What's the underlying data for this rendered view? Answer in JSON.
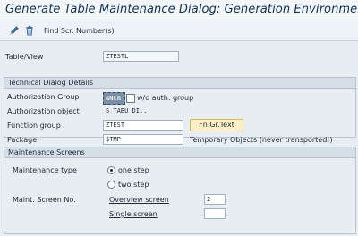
{
  "window": {
    "title": "Generate Table Maintenance Dialog: Generation Environment"
  },
  "toolbar": {
    "edit_icon": "pencil-icon",
    "delete_icon": "trash-icon",
    "find_label": "Find Scr. Number(s)"
  },
  "header": {
    "table_view_label": "Table/View",
    "table_view_value": "ZTESTL"
  },
  "technical": {
    "title": "Technical Dialog Details",
    "auth_group_label": "Authorization Group",
    "auth_group_value": "&NC&",
    "auth_group_text": "w/o auth. group",
    "auth_object_label": "Authorization object",
    "auth_object_value": "S_TABU_DI..",
    "function_group_label": "Function group",
    "function_group_value": "ZTEST",
    "fn_gr_text_button": "Fn.Gr.Text",
    "package_label": "Package",
    "package_value": "$TMP",
    "package_text": "Temporary Objects (never transported!)"
  },
  "maintenance": {
    "title": "Maintenance Screens",
    "type_label": "Maintenance type",
    "one_step_label": "one step",
    "two_step_label": "two step",
    "selected_type": "one step",
    "screen_no_label": "Maint. Screen No.",
    "overview_label": "Overview screen",
    "overview_value": "2",
    "single_label": "Single screen",
    "single_value": ""
  },
  "colors": {
    "button_bg": "#fbf0c4",
    "title_color": "#12324f",
    "auth_field_bg": "#7a8fa6"
  }
}
